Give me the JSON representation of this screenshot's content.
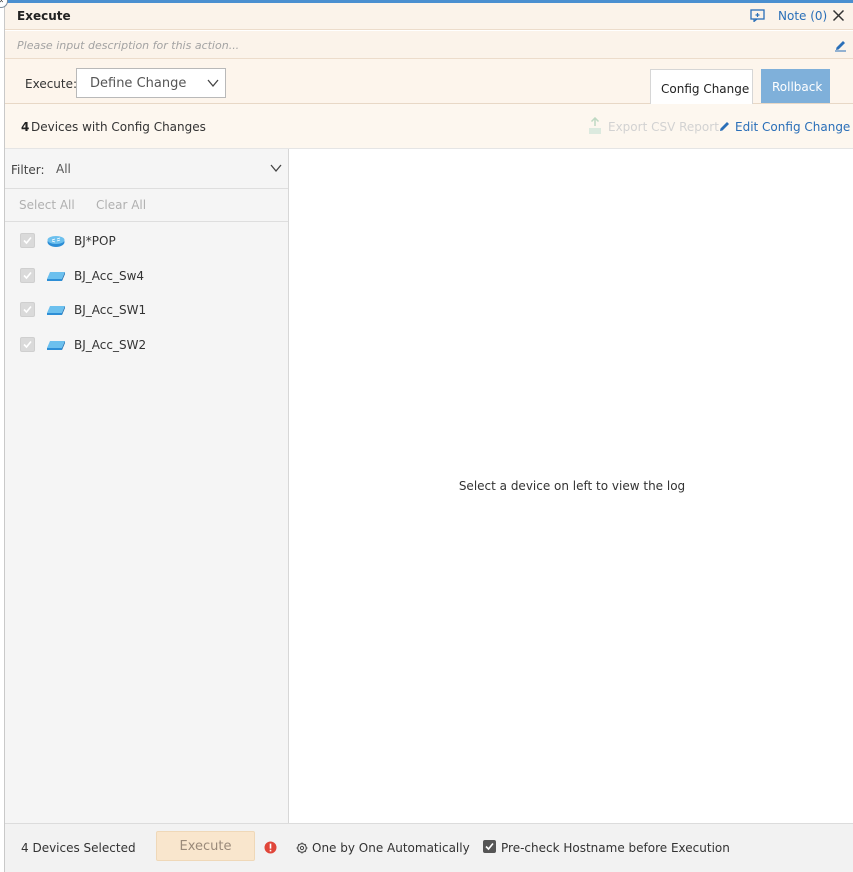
{
  "window": {
    "title": "Execute",
    "note_label": "Note (0)"
  },
  "description": {
    "placeholder": "Please input description for this action..."
  },
  "execute_row": {
    "label": "Execute:",
    "selected": "Define Change"
  },
  "tabs": [
    {
      "label": "Config Change",
      "active": true
    },
    {
      "label": "Rollback",
      "active": false
    }
  ],
  "summary": {
    "count": "4",
    "text": "Devices with Config Changes",
    "export_label": "Export CSV Report",
    "edit_label": "Edit Config Change"
  },
  "filter": {
    "label": "Filter:",
    "value": "All",
    "select_all": "Select All",
    "clear_all": "Clear All"
  },
  "devices": [
    {
      "name": "BJ*POP",
      "icon": "router-icon",
      "checked": true
    },
    {
      "name": "BJ_Acc_Sw4",
      "icon": "switch-icon",
      "checked": true
    },
    {
      "name": "BJ_Acc_SW1",
      "icon": "switch-icon",
      "checked": true
    },
    {
      "name": "BJ_Acc_SW2",
      "icon": "switch-icon",
      "checked": true
    }
  ],
  "log_panel": {
    "placeholder": "Select a device on left to view the log"
  },
  "footer": {
    "selected_text": "4 Devices Selected",
    "execute_label": "Execute",
    "mode_label": "One by One Automatically",
    "precheck_label": "Pre-check Hostname before Execution",
    "precheck_checked": true
  },
  "colors": {
    "accent": "#2a6fb8",
    "rollback_tab": "#7fb0da",
    "header_bg": "#fbf3ea",
    "alert": "#e0463a"
  }
}
